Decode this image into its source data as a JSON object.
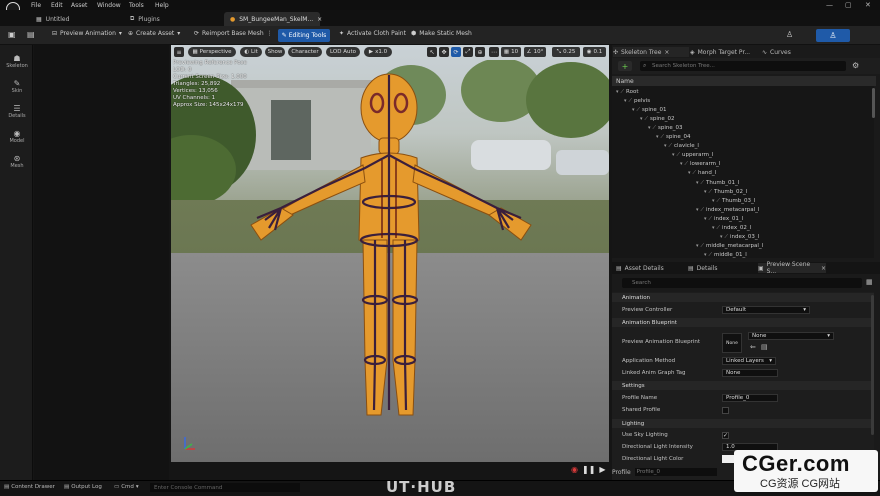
{
  "menu": [
    "File",
    "Edit",
    "Asset",
    "Window",
    "Tools",
    "Help"
  ],
  "window_controls": {
    "minimize": "—",
    "maximize": "▢",
    "close": "✕"
  },
  "tabs": {
    "untitled": "Untitled",
    "plugins": "Plugins",
    "mesh": "SM_BungeeMan_SkelM...",
    "mesh_close": "×"
  },
  "toolbar": {
    "preview_animation": "Preview Animation",
    "create_asset": "Create Asset",
    "reimport": "Reimport Base Mesh",
    "editing_tools": "Editing Tools",
    "cloth_paint": "Activate Cloth Paint",
    "static_mesh": "Make Static Mesh"
  },
  "left_toolbar": [
    {
      "label": "Skeleton",
      "icon": "skeleton-icon"
    },
    {
      "label": "Skin",
      "icon": "skin-icon"
    },
    {
      "label": "Details",
      "icon": "details-icon"
    },
    {
      "label": "Model",
      "icon": "model-icon"
    },
    {
      "label": "Mesh",
      "icon": "mesh-icon"
    }
  ],
  "viewport": {
    "perspective": "Perspective",
    "lit": "Lit",
    "show": "Show",
    "character": "Character",
    "lod": "LOD Auto",
    "speed": "x1.0",
    "grid_val": "10",
    "angle_val": "10°",
    "scale_val": "0.25",
    "cam_val": "0.1",
    "info": [
      "Previewing Reference Pose",
      "LOD: 0",
      "Current Screen Size: 1.000",
      "Triangles: 25,892",
      "Vertices: 13,056",
      "UV Channels: 1",
      "Approx Size: 145x24x179"
    ]
  },
  "right_tabs": {
    "skeleton_tree": "Skeleton Tree",
    "morph": "Morph Target Pr...",
    "curves": "Curves"
  },
  "skeleton": {
    "search_placeholder": "Search Skeleton Tree...",
    "header": "Name",
    "nodes": [
      {
        "name": "Root",
        "depth": 0
      },
      {
        "name": "pelvis",
        "depth": 1
      },
      {
        "name": "spine_01",
        "depth": 2
      },
      {
        "name": "spine_02",
        "depth": 3
      },
      {
        "name": "spine_03",
        "depth": 4
      },
      {
        "name": "spine_04",
        "depth": 5
      },
      {
        "name": "clavicle_l",
        "depth": 6
      },
      {
        "name": "upperarm_l",
        "depth": 7
      },
      {
        "name": "lowerarm_l",
        "depth": 8
      },
      {
        "name": "hand_l",
        "depth": 9
      },
      {
        "name": "Thumb_01_l",
        "depth": 10
      },
      {
        "name": "Thumb_02_l",
        "depth": 11
      },
      {
        "name": "Thumb_03_l",
        "depth": 12
      },
      {
        "name": "index_metacarpal_l",
        "depth": 10
      },
      {
        "name": "index_01_l",
        "depth": 11
      },
      {
        "name": "index_02_l",
        "depth": 12
      },
      {
        "name": "index_03_l",
        "depth": 13
      },
      {
        "name": "middle_metacarpal_l",
        "depth": 10
      },
      {
        "name": "middle_01_l",
        "depth": 11
      }
    ]
  },
  "details_tabs": {
    "asset_details": "Asset Details",
    "details": "Details",
    "preview_scene": "Preview Scene S..."
  },
  "details": {
    "search_placeholder": "Search",
    "animation_section": "Animation",
    "preview_controller_label": "Preview Controller",
    "preview_controller_value": "Default",
    "anim_bp_section": "Animation Blueprint",
    "preview_bp_label": "Preview Animation Blueprint",
    "preview_bp_thumb": "None",
    "preview_bp_value": "None",
    "app_method_label": "Application Method",
    "app_method_value": "Linked Layers",
    "linked_tag_label": "Linked Anim Graph Tag",
    "linked_tag_value": "None",
    "settings_section": "Settings",
    "profile_name_label": "Profile Name",
    "profile_name_value": "Profile_0",
    "shared_profile_label": "Shared Profile",
    "lighting_section": "Lighting",
    "sky_light_label": "Use Sky Lighting",
    "dir_intensity_label": "Directional Light Intensity",
    "dir_intensity_value": "1.0",
    "dir_color_label": "Directional Light Color",
    "check": "✓"
  },
  "profile_bar": {
    "label": "Profile",
    "value": "Profile_0"
  },
  "bottom": {
    "content_drawer": "Content Drawer",
    "output_log": "Output Log",
    "cmd": "Cmd",
    "console_placeholder": "Enter Console Command"
  },
  "watermark_center": "UT·HUB",
  "watermark": {
    "big": "CGer.com",
    "small": "CG资源 CG网站"
  },
  "colors": {
    "accent": "#1f5aa8",
    "mannequin": "#e59a2d",
    "bone": "#3a1f3c"
  }
}
